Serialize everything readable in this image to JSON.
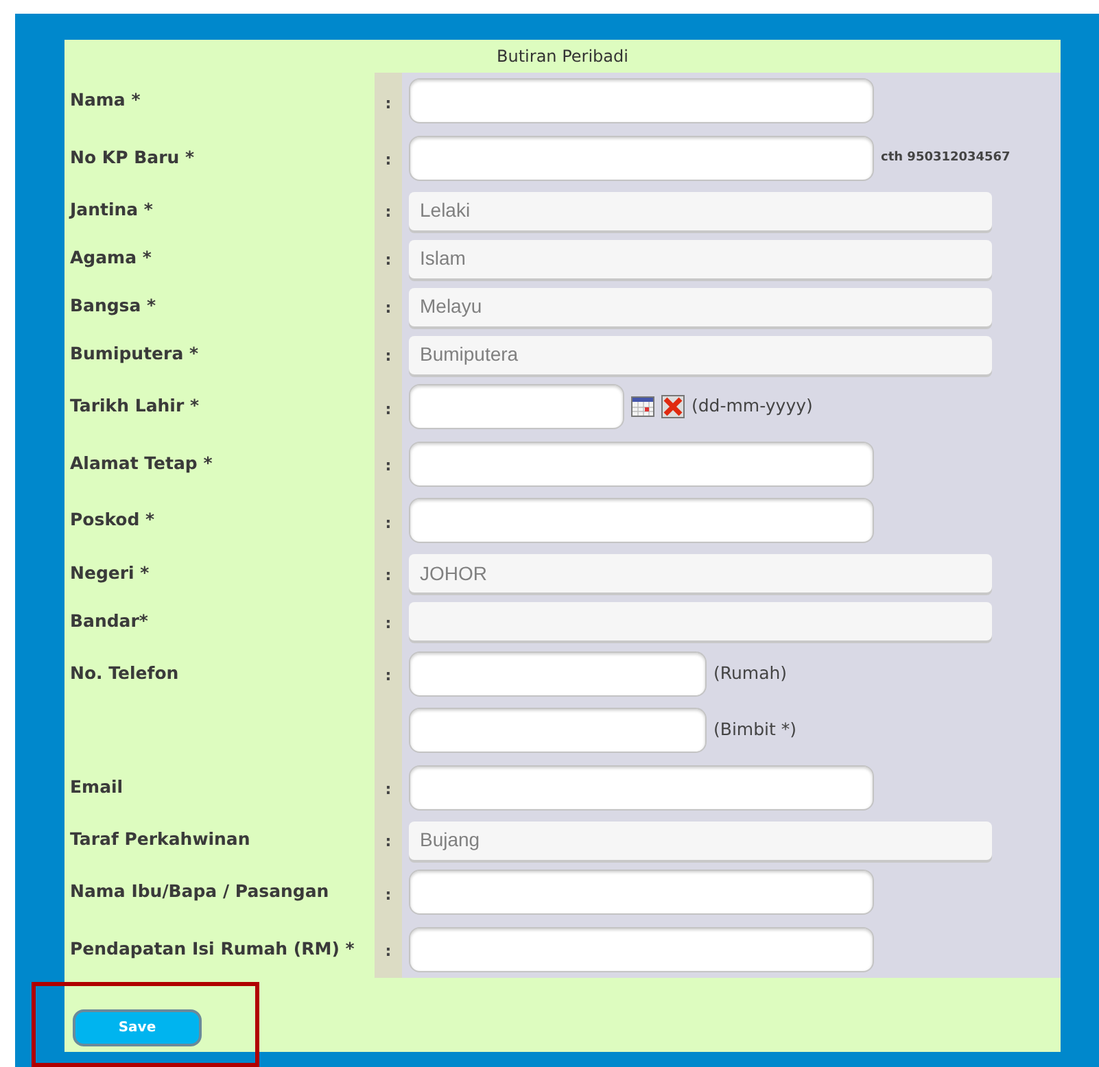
{
  "form": {
    "title": "Butiran Peribadi",
    "rows": [
      {
        "label": "Nama *",
        "separator": ":",
        "kind": "text"
      },
      {
        "label": "No KP Baru *",
        "separator": ":",
        "kind": "text",
        "hint": "cth 950312034567"
      },
      {
        "label": "Jantina *",
        "separator": ":",
        "kind": "select",
        "value": "Lelaki"
      },
      {
        "label": "Agama *",
        "separator": ":",
        "kind": "select",
        "value": "Islam"
      },
      {
        "label": "Bangsa *",
        "separator": ":",
        "kind": "select",
        "value": "Melayu"
      },
      {
        "label": "Bumiputera *",
        "separator": ":",
        "kind": "select",
        "value": "Bumiputera"
      },
      {
        "label": "Tarikh Lahir *",
        "separator": ":",
        "kind": "date",
        "hint": "(dd-mm-yyyy)"
      },
      {
        "label": "Alamat Tetap *",
        "separator": ":",
        "kind": "text"
      },
      {
        "label": "Poskod *",
        "separator": ":",
        "kind": "text"
      },
      {
        "label": "Negeri *",
        "separator": ":",
        "kind": "select",
        "value": "JOHOR"
      },
      {
        "label": "Bandar*",
        "separator": ":",
        "kind": "select"
      },
      {
        "label": "No. Telefon",
        "separator": ":",
        "kind": "phone",
        "hint": "(Rumah)"
      },
      {
        "kind": "phone",
        "hint": "(Bimbit *)"
      },
      {
        "label": "Email",
        "separator": ":",
        "kind": "text"
      },
      {
        "label": "Taraf Perkahwinan",
        "separator": ":",
        "kind": "select",
        "value": "Bujang"
      },
      {
        "label": "Nama Ibu/Bapa / Pasangan",
        "separator": ":",
        "kind": "text"
      },
      {
        "label": "Pendapatan Isi Rumah (RM) *",
        "separator": ":",
        "kind": "text"
      }
    ],
    "button": "Save"
  }
}
